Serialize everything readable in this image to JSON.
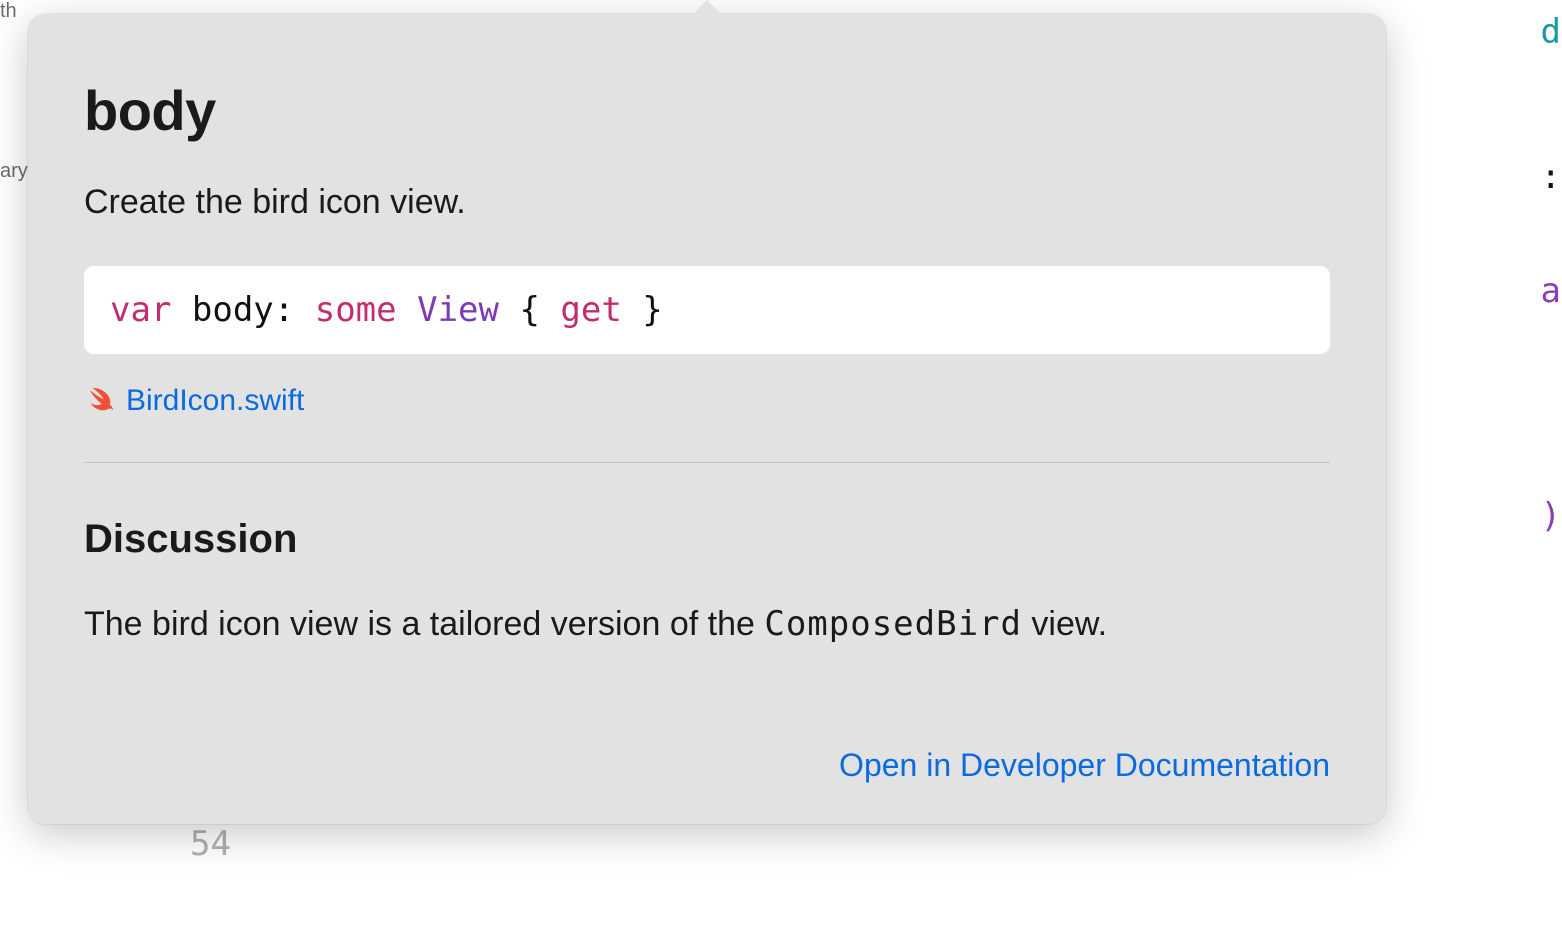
{
  "background": {
    "left_label_1": "th",
    "left_label_2": "ary",
    "right_code_line1": "d",
    "right_code_line2": ":",
    "right_code_line3": "a",
    "right_code_line4": ")",
    "line_number": "54"
  },
  "popover": {
    "title": "body",
    "subtitle": "Create the bird icon view.",
    "declaration": {
      "tokens": [
        {
          "text": "var",
          "kind": "kw-pink"
        },
        {
          "text": " body: ",
          "kind": "plain"
        },
        {
          "text": "some",
          "kind": "kw-pink"
        },
        {
          "text": " ",
          "kind": "plain"
        },
        {
          "text": "View",
          "kind": "kw-purple"
        },
        {
          "text": " { ",
          "kind": "plain"
        },
        {
          "text": "get",
          "kind": "kw-pink"
        },
        {
          "text": " }",
          "kind": "plain"
        }
      ]
    },
    "file_link": "BirdIcon.swift",
    "discussion_heading": "Discussion",
    "discussion_prefix": "The bird icon view is a tailored version of the ",
    "discussion_code": "ComposedBird",
    "discussion_suffix": " view.",
    "open_docs_label": "Open in Developer Documentation"
  }
}
